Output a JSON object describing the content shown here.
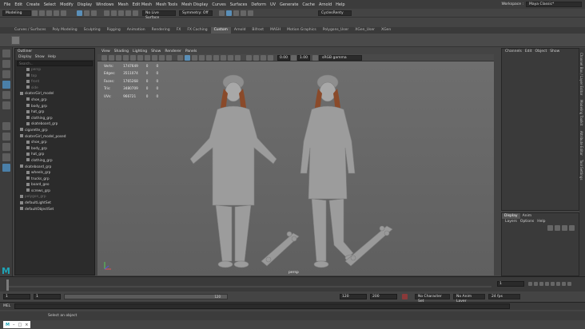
{
  "menubar": [
    "File",
    "Edit",
    "Create",
    "Select",
    "Modify",
    "Display",
    "Windows",
    "Mesh",
    "Edit Mesh",
    "Mesh Tools",
    "Mesh Display",
    "Curves",
    "Surfaces",
    "Deform",
    "UV",
    "Generate",
    "Cache",
    "Arnold",
    "Help"
  ],
  "workspace": {
    "label": "Workspace :",
    "value": "Maya Classic*"
  },
  "status": {
    "mode": "Modeling",
    "live": "No Live Surface",
    "symmetry": "Symmetry: Off",
    "camera": "CyclesRenty"
  },
  "shelf_tabs": [
    "Curves / Surfaces",
    "Poly Modeling",
    "Sculpting",
    "Rigging",
    "Animation",
    "Rendering",
    "FX",
    "FX Caching",
    "Custom",
    "Arnold",
    "Bifrost",
    "MASH",
    "Motion Graphics",
    "Polygons_User",
    "XGen_User",
    "XGen"
  ],
  "shelf_active": "Custom",
  "outliner": {
    "title": "Outliner",
    "menus": [
      "Display",
      "Show",
      "Help"
    ],
    "search_placeholder": "Search...",
    "items": [
      {
        "label": "persp",
        "dim": true,
        "indent": 1
      },
      {
        "label": "top",
        "dim": true,
        "indent": 1
      },
      {
        "label": "front",
        "dim": true,
        "indent": 1
      },
      {
        "label": "side",
        "dim": true,
        "indent": 1
      },
      {
        "label": "skaterGirl_model",
        "indent": 0
      },
      {
        "label": "shoe_grp",
        "indent": 1
      },
      {
        "label": "body_grp",
        "indent": 1
      },
      {
        "label": "hat_grp",
        "indent": 1
      },
      {
        "label": "clothing_grp",
        "indent": 1
      },
      {
        "label": "skateboard_grp",
        "indent": 1
      },
      {
        "label": "cigarette_grp",
        "indent": 0
      },
      {
        "label": "skaterGirl_model_posed",
        "indent": 0
      },
      {
        "label": "shoe_grp",
        "indent": 1
      },
      {
        "label": "body_grp",
        "indent": 1
      },
      {
        "label": "hat_grp",
        "indent": 1
      },
      {
        "label": "clothing_grp",
        "indent": 1
      },
      {
        "label": "skateboard_grp",
        "indent": 0
      },
      {
        "label": "wheels_grp",
        "indent": 1
      },
      {
        "label": "trucks_grp",
        "indent": 1
      },
      {
        "label": "board_geo",
        "indent": 1
      },
      {
        "label": "screws_grp",
        "indent": 1
      },
      {
        "label": "polygon_grp",
        "dim": true,
        "indent": 0
      },
      {
        "label": "defaultLightSet",
        "indent": 0
      },
      {
        "label": "defaultObjectSet",
        "indent": 0
      }
    ]
  },
  "viewport": {
    "menus": [
      "View",
      "Shading",
      "Lighting",
      "Show",
      "Renderer",
      "Panels"
    ],
    "exposure": "0.00",
    "gamma": "1.00",
    "colorspace": "sRGB gamma",
    "camera_label": "persp",
    "hud": [
      {
        "label": "Verts:",
        "v1": "1747649",
        "v2": "0",
        "v3": "0"
      },
      {
        "label": "Edges:",
        "v1": "3511074",
        "v2": "0",
        "v3": "0"
      },
      {
        "label": "Faces:",
        "v1": "1765268",
        "v2": "0",
        "v3": "0"
      },
      {
        "label": "Tris:",
        "v1": "3480709",
        "v2": "0",
        "v3": "0"
      },
      {
        "label": "UVs:",
        "v1": "966721",
        "v2": "0",
        "v3": "0"
      }
    ]
  },
  "channel_box": {
    "menus": [
      "Channels",
      "Edit",
      "Object",
      "Show"
    ]
  },
  "layer_editor": {
    "tabs": [
      "Display",
      "Anim"
    ],
    "menus": [
      "Layers",
      "Options",
      "Help"
    ]
  },
  "right_tabs": [
    "Channel Box / Layer Editor",
    "Modeling Toolkit",
    "Attribute Editor",
    "Tool Settings"
  ],
  "timeline": {
    "start": "1",
    "current": "1"
  },
  "range": {
    "start": "1",
    "inner_start": "1",
    "inner_end": "120",
    "end": "120",
    "end2": "200",
    "character": "No Character Set",
    "anim_layer": "No Anim Layer",
    "fps": "24 fps"
  },
  "cmdline": {
    "label": "MEL"
  },
  "helpline": {
    "text": "Select an object"
  },
  "colors": {
    "accent": "#5a8fb8",
    "viewport_bg": "#666666",
    "panel": "#3a3a3a",
    "field": "#2a2a2a",
    "logo": "#1fa3b5"
  }
}
